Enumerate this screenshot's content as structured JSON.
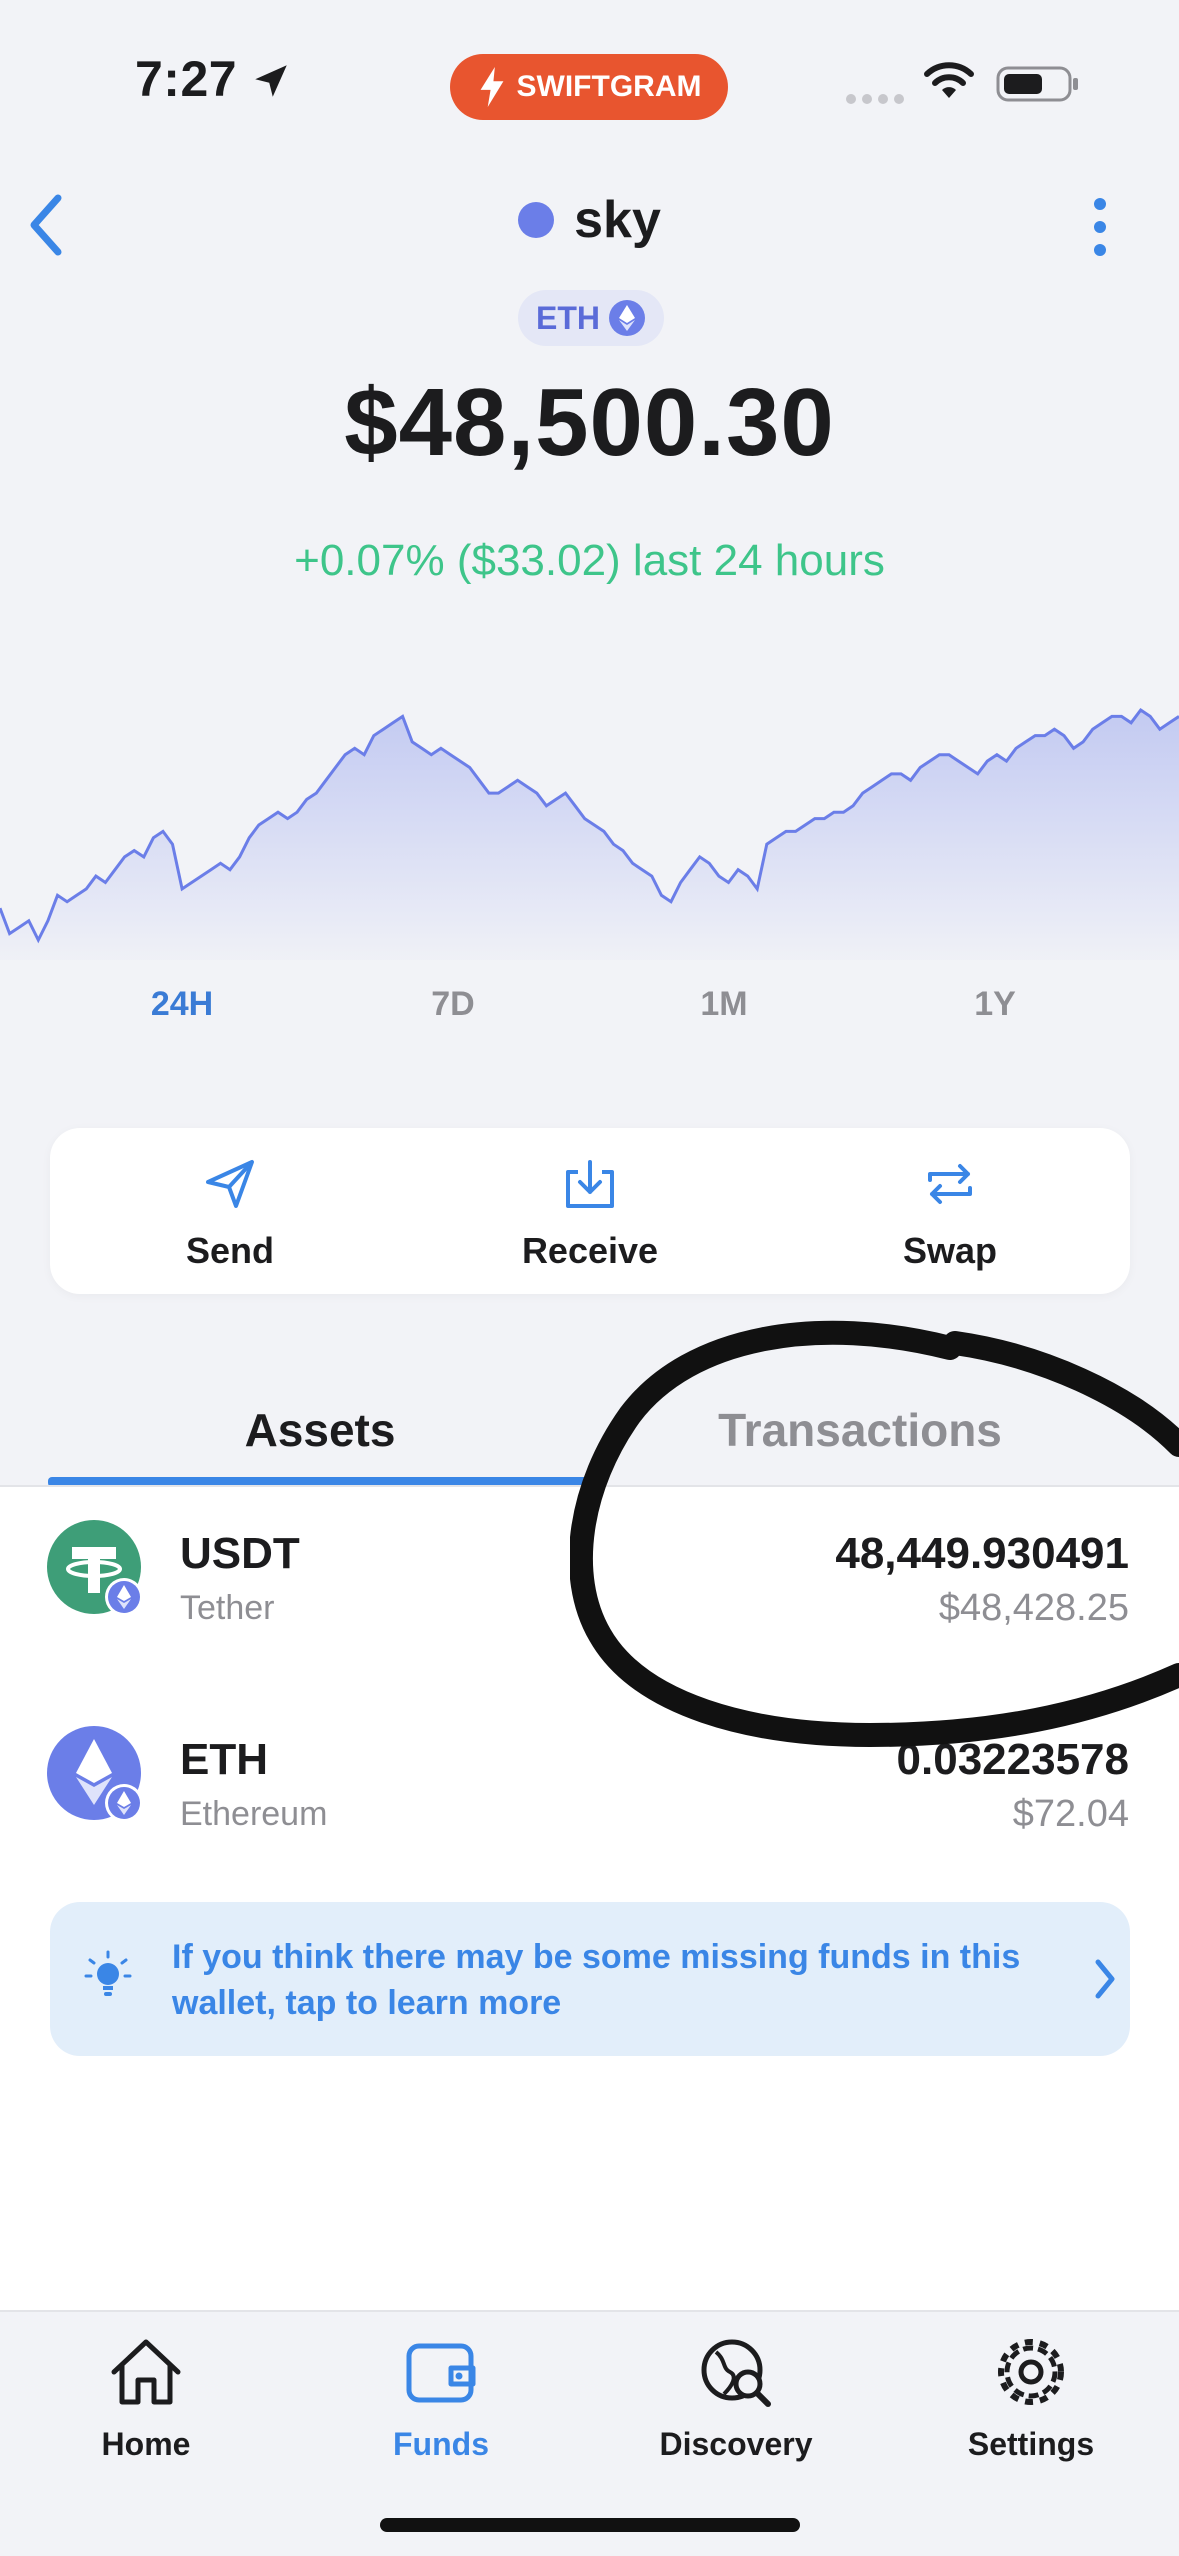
{
  "status_bar": {
    "time": "7:27",
    "app_name": "SWIFTGRAM"
  },
  "header": {
    "wallet_name": "sky",
    "chain": "ETH",
    "balance": "$48,500.30",
    "change": "+0.07% ($33.02) last 24 hours"
  },
  "chart": {
    "series": [
      52,
      48,
      49,
      50,
      47,
      50,
      54,
      53,
      54,
      55,
      57,
      56,
      58,
      60,
      61,
      60,
      63,
      64,
      62,
      55,
      56,
      57,
      58,
      59,
      58,
      60,
      63,
      65,
      66,
      67,
      66,
      67,
      69,
      70,
      72,
      74,
      76,
      77,
      76,
      79,
      80,
      81,
      82,
      78,
      77,
      76,
      77,
      76,
      75,
      74,
      72,
      70,
      70,
      71,
      72,
      71,
      70,
      68,
      69,
      70,
      68,
      66,
      65,
      64,
      62,
      61,
      59,
      58,
      57,
      54,
      53,
      56,
      58,
      60,
      59,
      57,
      56,
      58,
      57,
      55,
      62,
      63,
      64,
      64,
      65,
      66,
      66,
      67,
      67,
      68,
      70,
      71,
      72,
      73,
      73,
      72,
      74,
      75,
      76,
      76,
      75,
      74,
      73,
      75,
      76,
      75,
      77,
      78,
      79,
      79,
      80,
      79,
      77,
      78,
      80,
      81,
      82,
      82,
      81,
      83,
      82,
      80,
      81,
      82
    ],
    "accent": "#6b7ee8"
  },
  "ranges": [
    "24H",
    "7D",
    "1M",
    "1Y"
  ],
  "active_range": "24H",
  "actions": {
    "send": "Send",
    "receive": "Receive",
    "swap": "Swap"
  },
  "tabs": {
    "assets": "Assets",
    "transactions": "Transactions"
  },
  "assets": [
    {
      "symbol": "USDT",
      "name": "Tether",
      "amount": "48,449.930491",
      "value": "$48,428.25",
      "icon": "tether-icon",
      "color": "#3e9e78"
    },
    {
      "symbol": "ETH",
      "name": "Ethereum",
      "amount": "0.03223578",
      "value": "$72.04",
      "icon": "ethereum-icon",
      "color": "#6b7ee8"
    }
  ],
  "info_banner": {
    "text": "If you think there may be some missing funds in this wallet, tap to learn more"
  },
  "bottom_nav": {
    "home": "Home",
    "funds": "Funds",
    "discovery": "Discovery",
    "settings": "Settings"
  },
  "colors": {
    "accent_blue": "#3a86e6",
    "positive_green": "#3ec58a",
    "pill_orange": "#e8552f"
  }
}
